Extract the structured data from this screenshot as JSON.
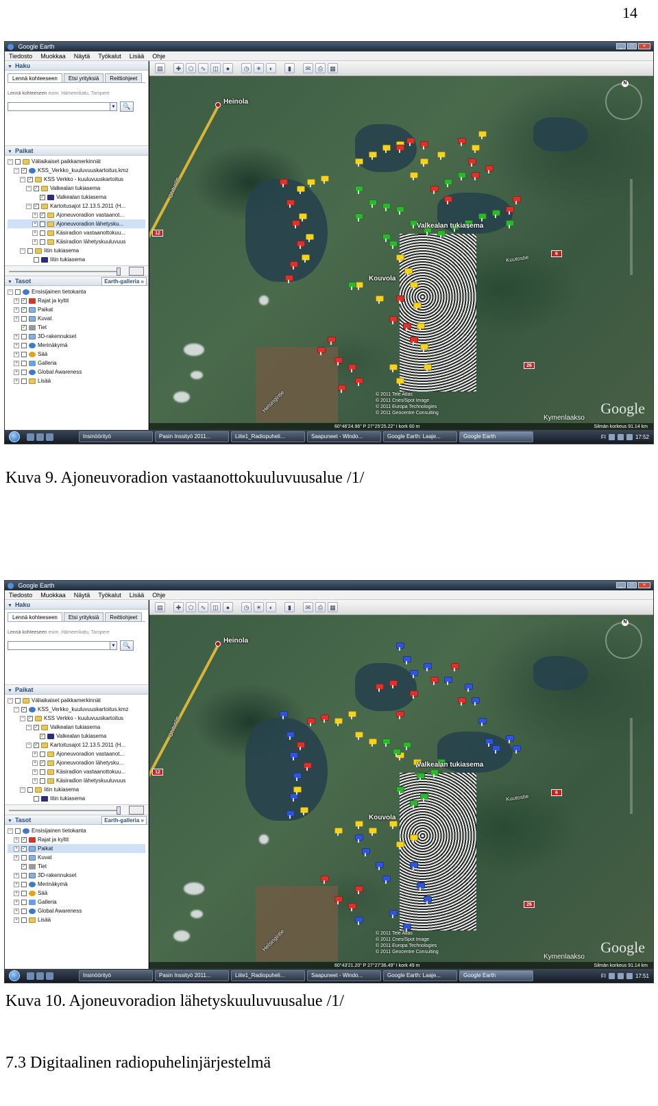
{
  "page_number": "14",
  "figures": [
    {
      "window_title": "Google Earth",
      "menu": [
        "Tiedosto",
        "Muokkaa",
        "Näytä",
        "Työkalut",
        "Lisää",
        "Ohje"
      ],
      "search": {
        "header": "Haku",
        "tabs": [
          "Lennä kohteeseen",
          "Etsi yrityksiä",
          "Reittiohjeet"
        ],
        "hint": "Lennä kohteeseen",
        "example": "esim. Hämeenkatu, Tampere",
        "go_label": "🔍"
      },
      "places": {
        "header": "Paikat",
        "items": [
          {
            "label": "Väliaikaiset paikkamerkinnät",
            "indent": 0,
            "exp": "−",
            "checked": false,
            "icon": "folder"
          },
          {
            "label": "KSS_Verkko_kuuluvuuskartoitus.kmz",
            "indent": 1,
            "exp": "−",
            "checked": true,
            "icon": "globe"
          },
          {
            "label": "KSS Verkko - kuuluvuuskartoitus",
            "indent": 2,
            "exp": "−",
            "checked": true,
            "icon": "folder"
          },
          {
            "label": "Valkealan tukiasema",
            "indent": 3,
            "exp": "−",
            "checked": true,
            "icon": "folder"
          },
          {
            "label": "Valkealan tukiasema",
            "indent": 4,
            "exp": "",
            "checked": true,
            "icon": "tower"
          },
          {
            "label": "Kartoitusajot 12.13.5.2011 (H...",
            "indent": 3,
            "exp": "−",
            "checked": true,
            "icon": "folder"
          },
          {
            "label": "Ajoneuvoradion vastaanot...",
            "indent": 4,
            "exp": "+",
            "checked": true,
            "icon": "folder"
          },
          {
            "label": "Ajoneuvoradion lähetysku...",
            "indent": 4,
            "exp": "+",
            "checked": false,
            "icon": "folder",
            "selected": true
          },
          {
            "label": "Käsiradion vastaanottokuu...",
            "indent": 4,
            "exp": "+",
            "checked": false,
            "icon": "folder"
          },
          {
            "label": "Käsiradion lähetyskuuluvuus",
            "indent": 4,
            "exp": "+",
            "checked": false,
            "icon": "folder"
          },
          {
            "label": "Iitin tukiasema",
            "indent": 2,
            "exp": "−",
            "checked": false,
            "icon": "folder"
          },
          {
            "label": "Iitin tukiasema",
            "indent": 3,
            "exp": "",
            "checked": false,
            "icon": "tower"
          }
        ]
      },
      "layers": {
        "header": "Tasot",
        "gallery": "Earth-galleria »",
        "items": [
          {
            "label": "Ensisijainen tietokanta",
            "indent": 0,
            "exp": "−",
            "checked": false,
            "icon": "globe"
          },
          {
            "label": "Rajat ja kyltit",
            "indent": 1,
            "exp": "+",
            "checked": true,
            "icon": "flag"
          },
          {
            "label": "Paikat",
            "indent": 1,
            "exp": "+",
            "checked": true,
            "icon": "layer"
          },
          {
            "label": "Kuvat",
            "indent": 1,
            "exp": "+",
            "checked": false,
            "icon": "layer"
          },
          {
            "label": "Tiet",
            "indent": 1,
            "exp": "",
            "checked": true,
            "icon": "road"
          },
          {
            "label": "3D-rakennukset",
            "indent": 1,
            "exp": "+",
            "checked": false,
            "icon": "layer"
          },
          {
            "label": "Merinäkymä",
            "indent": 1,
            "exp": "+",
            "checked": false,
            "icon": "globe"
          },
          {
            "label": "Sää",
            "indent": 1,
            "exp": "+",
            "checked": false,
            "icon": "sun"
          },
          {
            "label": "Galleria",
            "indent": 1,
            "exp": "+",
            "checked": false,
            "icon": "star"
          },
          {
            "label": "Global Awareness",
            "indent": 1,
            "exp": "+",
            "checked": false,
            "icon": "globe"
          },
          {
            "label": "Lisää",
            "indent": 1,
            "exp": "+",
            "checked": false,
            "icon": "folder"
          }
        ]
      },
      "map": {
        "labels": [
          "Heinola",
          "Valkealan tukiasema",
          "Kouvola",
          "Kuutostie",
          "Ohitustie",
          "Helsingintie",
          "Kymenlaakso"
        ],
        "road_signs": [
          "12",
          "6",
          "26"
        ],
        "copyright": [
          "© 2011 Tele Atlas",
          "© 2011 Cnes/Spot Image",
          "© 2011 Europa Technologies",
          "© 2011 Geocentre Consulting"
        ],
        "coords": "60°46'24.96\" P   27°25'25.22\" I   kork   60 m",
        "eye_alt": "Silmän korkeus   91.14 km",
        "google": "Google",
        "compass_n": "N"
      },
      "taskbar": {
        "tasks": [
          "Insinöörityö",
          "Pasin Inssityö 2011...",
          "Liite1_Radiopuheli...",
          "Saapuneet - Windo...",
          "Google Earth: Laaje...",
          "Google Earth"
        ],
        "lang": "FI",
        "time": "17:52"
      },
      "pin_colors": {
        "red": "#d9342b",
        "yellow": "#f2d320",
        "green": "#2fb52f",
        "blue": "#2f55d9"
      }
    },
    {
      "window_title": "Google Earth",
      "menu": [
        "Tiedosto",
        "Muokkaa",
        "Näytä",
        "Työkalut",
        "Lisää",
        "Ohje"
      ],
      "search": {
        "header": "Haku",
        "tabs": [
          "Lennä kohteeseen",
          "Etsi yrityksiä",
          "Reittiohjeet"
        ],
        "hint": "Lennä kohteeseen",
        "example": "esim. Hämeenkatu, Tampere",
        "go_label": "🔍"
      },
      "places": {
        "header": "Paikat",
        "items": [
          {
            "label": "Väliaikaiset paikkamerkinnät",
            "indent": 0,
            "exp": "−",
            "checked": false,
            "icon": "folder"
          },
          {
            "label": "KSS_Verkko_kuuluvuuskartoitus.kmz",
            "indent": 1,
            "exp": "−",
            "checked": true,
            "icon": "globe"
          },
          {
            "label": "KSS Verkko - kuuluvuuskartoitus",
            "indent": 2,
            "exp": "−",
            "checked": true,
            "icon": "folder"
          },
          {
            "label": "Valkealan tukiasema",
            "indent": 3,
            "exp": "−",
            "checked": true,
            "icon": "folder"
          },
          {
            "label": "Valkealan tukiasema",
            "indent": 4,
            "exp": "",
            "checked": true,
            "icon": "tower"
          },
          {
            "label": "Kartoitusajot 12.13.5.2011 (H...",
            "indent": 3,
            "exp": "−",
            "checked": true,
            "icon": "folder"
          },
          {
            "label": "Ajoneuvoradion vastaanot...",
            "indent": 4,
            "exp": "+",
            "checked": false,
            "icon": "folder"
          },
          {
            "label": "Ajoneuvoradion lähetysku...",
            "indent": 4,
            "exp": "+",
            "checked": true,
            "icon": "folder"
          },
          {
            "label": "Käsiradion vastaanottokuu...",
            "indent": 4,
            "exp": "+",
            "checked": false,
            "icon": "folder"
          },
          {
            "label": "Käsiradion lähetyskuuluvuus",
            "indent": 4,
            "exp": "+",
            "checked": false,
            "icon": "folder"
          },
          {
            "label": "Iitin tukiasema",
            "indent": 2,
            "exp": "−",
            "checked": false,
            "icon": "folder"
          },
          {
            "label": "Iitin tukiasema",
            "indent": 3,
            "exp": "",
            "checked": false,
            "icon": "tower"
          }
        ]
      },
      "layers": {
        "header": "Tasot",
        "gallery": "Earth-galleria »",
        "items": [
          {
            "label": "Ensisijainen tietokanta",
            "indent": 0,
            "exp": "−",
            "checked": false,
            "icon": "globe"
          },
          {
            "label": "Rajat ja kyltit",
            "indent": 1,
            "exp": "+",
            "checked": true,
            "icon": "flag"
          },
          {
            "label": "Paikat",
            "indent": 1,
            "exp": "+",
            "checked": true,
            "icon": "layer",
            "selected": true
          },
          {
            "label": "Kuvat",
            "indent": 1,
            "exp": "+",
            "checked": false,
            "icon": "layer"
          },
          {
            "label": "Tiet",
            "indent": 1,
            "exp": "",
            "checked": true,
            "icon": "road"
          },
          {
            "label": "3D-rakennukset",
            "indent": 1,
            "exp": "+",
            "checked": false,
            "icon": "layer"
          },
          {
            "label": "Merinäkymä",
            "indent": 1,
            "exp": "+",
            "checked": false,
            "icon": "globe"
          },
          {
            "label": "Sää",
            "indent": 1,
            "exp": "+",
            "checked": false,
            "icon": "sun"
          },
          {
            "label": "Galleria",
            "indent": 1,
            "exp": "+",
            "checked": false,
            "icon": "star"
          },
          {
            "label": "Global Awareness",
            "indent": 1,
            "exp": "+",
            "checked": false,
            "icon": "globe"
          },
          {
            "label": "Lisää",
            "indent": 1,
            "exp": "+",
            "checked": false,
            "icon": "folder"
          }
        ]
      },
      "map": {
        "labels": [
          "Heinola",
          "Valkealan tukiasema",
          "Kouvola",
          "Kuutostie",
          "Ohitustie",
          "Helsingintie",
          "Kymenlaakso"
        ],
        "road_signs": [
          "12",
          "6",
          "26"
        ],
        "copyright": [
          "© 2011 Tele Atlas",
          "© 2011 Cnes/Spot Image",
          "© 2011 Europa Technologies",
          "© 2011 Geocentre Consulting"
        ],
        "coords": "60°43'21.20\" P   27°27'36.49\" I   kork   49 m",
        "eye_alt": "Silmän korkeus   91.14 km",
        "google": "Google",
        "compass_n": "N"
      },
      "taskbar": {
        "tasks": [
          "Insinöörityö",
          "Pasin Inssityö 2011...",
          "Liite1_Radiopuheli...",
          "Saapuneet - Windo...",
          "Google Earth: Laaje...",
          "Google Earth"
        ],
        "lang": "FI",
        "time": "17:51"
      },
      "pin_colors": {
        "red": "#d9342b",
        "yellow": "#f2d320",
        "green": "#2fb52f",
        "blue": "#2f55d9"
      }
    }
  ],
  "captions": [
    "Kuva 9. Ajoneuvoradion vastaanottokuuluvuusalue /1/",
    "Kuva 10. Ajoneuvoradion lähetyskuuluvuusalue /1/"
  ],
  "section_heading": "7.3 Digitaalinen radiopuhelinjärjestelmä"
}
